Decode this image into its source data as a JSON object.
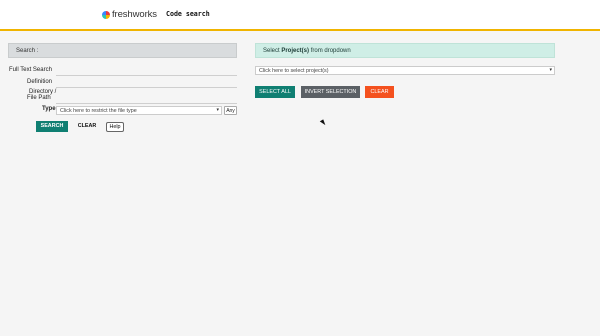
{
  "header": {
    "logo_text": "freshworks",
    "title": "Code search"
  },
  "left_panel": {
    "search_label": "Search :",
    "full_text_label": "Full Text Search",
    "definition_label": "Definition",
    "directory_label": "Directory /",
    "file_path_label": "File Path",
    "type_label": "Type",
    "type_placeholder": "Click here to restrict the file type",
    "any_label": "Any",
    "search_button": "SEARCH",
    "clear_button": "CLEAR",
    "help_button": "Help"
  },
  "right_panel": {
    "banner_prefix": "Select ",
    "banner_bold": "Project(s)",
    "banner_suffix": " from dropdown",
    "project_placeholder": "Click here to select project(s)",
    "select_all_button": "SELECT ALL",
    "invert_button": "INVERT SELECTION",
    "clear_button": "CLEAR"
  },
  "colors": {
    "primary": "#0f7f72",
    "danger": "#f4511e",
    "neutral": "#5b6065",
    "accent_bar": "#f0b400"
  }
}
